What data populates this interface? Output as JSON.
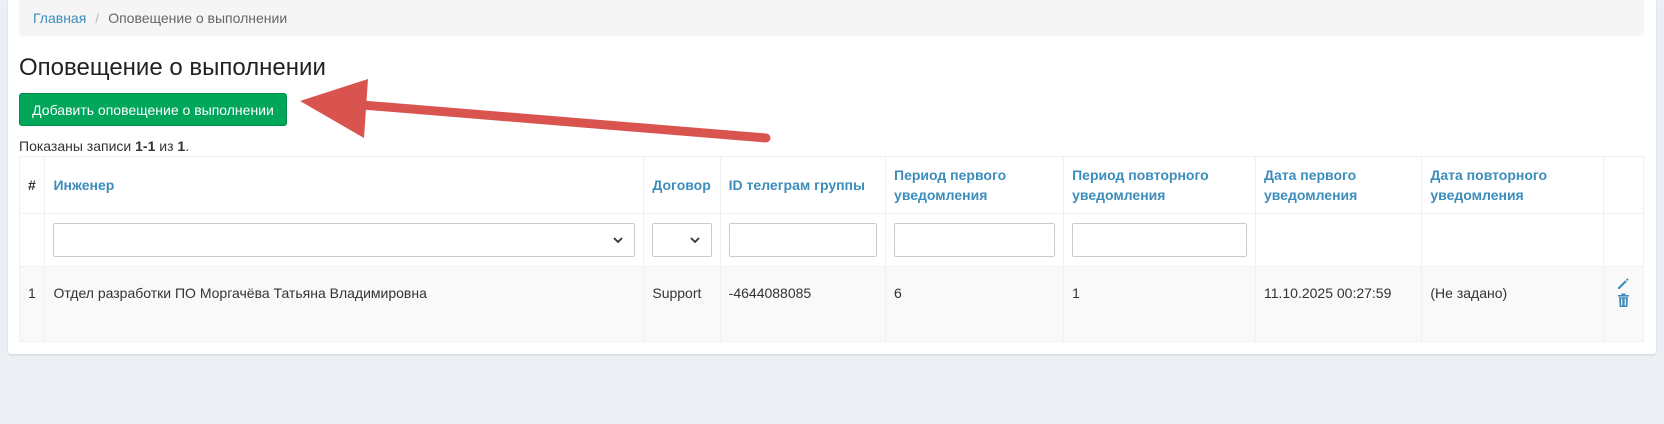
{
  "breadcrumb": {
    "home": "Главная",
    "separator": "/",
    "current": "Оповещение о выполнении"
  },
  "page": {
    "title": "Оповещение о выполнении",
    "add_button": "Добавить оповещение о выполнении"
  },
  "summary": {
    "prefix": "Показаны записи ",
    "range": "1-1",
    "of": " из ",
    "total": "1",
    "suffix": "."
  },
  "table": {
    "columns": [
      "#",
      "Инженер",
      "Договор",
      "ID телеграм группы",
      "Период первого уведомления",
      "Период повторного уведомления",
      "Дата первого уведомления",
      "Дата повторного уведомления"
    ],
    "filters": {
      "engineer": "",
      "contract": "",
      "telegram_id": "",
      "first_period": "",
      "repeat_period": ""
    },
    "rows": [
      {
        "num": "1",
        "engineer": "Отдел разработки ПО Моргачёва Татьяна Владимировна",
        "contract": "Support",
        "telegram_id": "-4644088085",
        "first_period": "6",
        "repeat_period": "1",
        "first_date": "11.10.2025 00:27:59",
        "repeat_date": "(Не задано)"
      }
    ]
  },
  "colors": {
    "link": "#3c8dbc",
    "success": "#00a65a",
    "annotation_arrow": "#d9534f"
  },
  "icons": [
    "chevron-down-icon",
    "pencil-icon",
    "trash-icon"
  ]
}
